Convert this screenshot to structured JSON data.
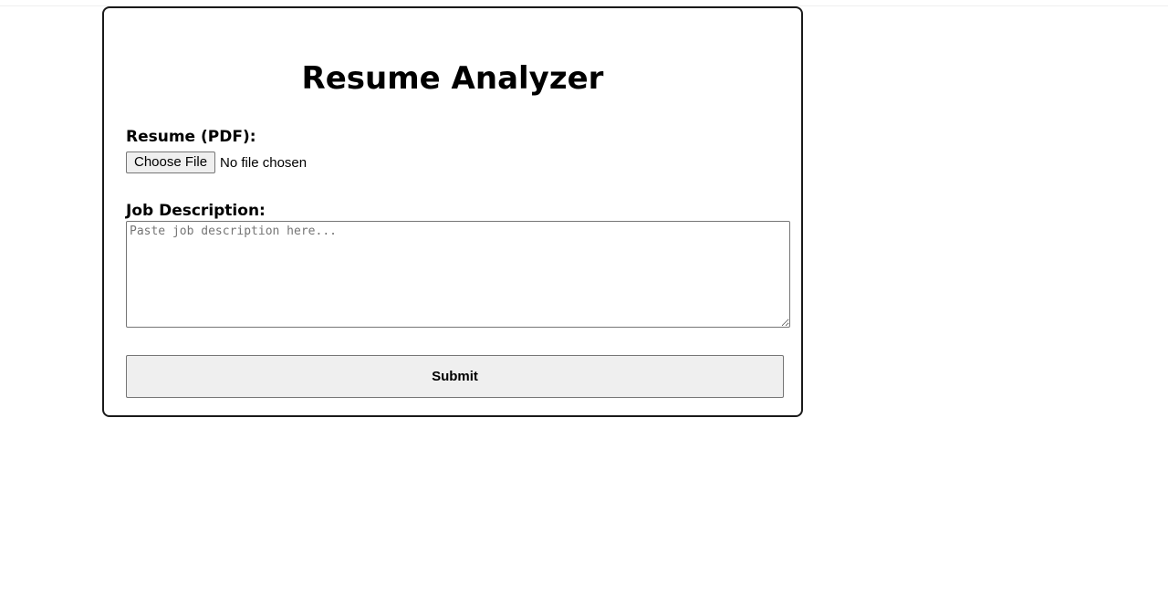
{
  "form": {
    "title": "Resume Analyzer",
    "resume_label": "Resume (PDF):",
    "choose_file_label": "Choose File",
    "file_status": "No file chosen",
    "job_label": "Job Description:",
    "job_placeholder": "Paste job description here...",
    "job_value": "",
    "submit_label": "Submit"
  }
}
